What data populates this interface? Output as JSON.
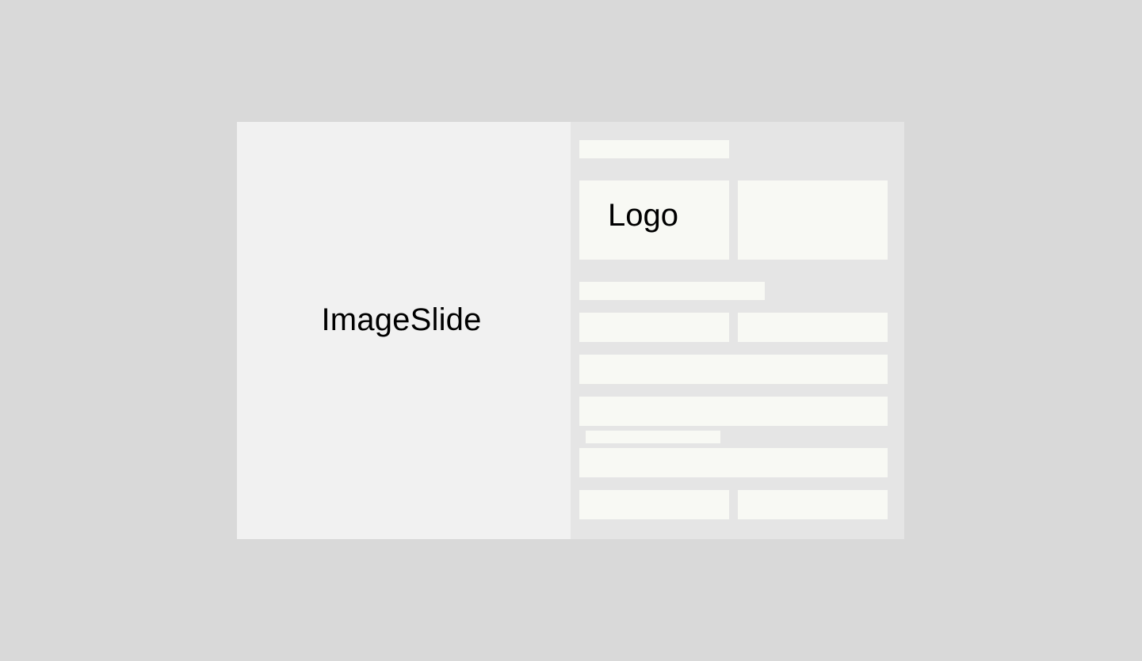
{
  "image_slide": {
    "label": "ImageSlide"
  },
  "panel": {
    "logo_label": "Logo"
  },
  "colors": {
    "page_background": "#d9d9d9",
    "image_slide_background": "#f1f1f1",
    "panel_background": "#e5e5e5",
    "placeholder_block": "#f8f9f4",
    "text": "#000000"
  }
}
